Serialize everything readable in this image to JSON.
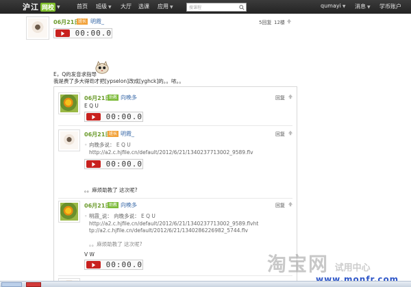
{
  "nav": {
    "logo_text": "沪江",
    "logo_box": "网校",
    "items": [
      "首页",
      "班级",
      "大厅",
      "选课",
      "应用"
    ],
    "search_placeholder": "搜课程",
    "username": "qumayi",
    "messages": "消息",
    "account": "学币账户"
  },
  "post": {
    "date": "06月21日",
    "badge": "班长",
    "user": "明霞_",
    "reply_count": "5回复",
    "floor": "12楼",
    "player_time": "00:00.0",
    "text_line1": "E，Q的发音求指导",
    "text_line2": "我是费了多大得劲才把[ypselon]改成[yghck]的。。哝。。"
  },
  "replies": [
    {
      "date": "06月21日",
      "badge": "助教",
      "user": "向晚多",
      "reply_label": "回复",
      "text": "E Q   U",
      "player_time": "00:00.0"
    },
    {
      "date": "06月21日",
      "badge": "班长",
      "user": "明霞_",
      "reply_label": "回复",
      "quote": "向晚多说： E Q  U",
      "link": "http://a2.c.hjfile.cn/default/2012/6/21/1340237713002_9589.flv",
      "player_time": "00:00.0",
      "text": "。。麻烦助教了 这次呢?"
    },
    {
      "date": "06月21日",
      "badge": "助教",
      "user": "向晚多",
      "reply_label": "回复",
      "quote_line1": "明霞_说： 向晚多说： E Q  U",
      "quote_line2": "http://a2.c.hjfile.cn/default/2012/6/21/1340237713002_9589.flvht",
      "quote_line3": "tp://a2.c.hjfile.cn/default/2012/6/21/1340286226982_5744.flv",
      "quote_line4": "。。麻烦助教了 这次呢?",
      "text": "V  W",
      "player_time": "00:00.0"
    }
  ],
  "watermark": {
    "big": "淘宝网",
    "small": "试用中心",
    "url": "www.monfr.com"
  },
  "colors": {
    "nav_bg": "#2b2b2b",
    "date_green": "#6a9a2a",
    "badge_orange": "#f2a23a",
    "badge_green": "#7dbb3a",
    "play_red": "#c8211e",
    "link_blue": "#3a6aa8"
  }
}
